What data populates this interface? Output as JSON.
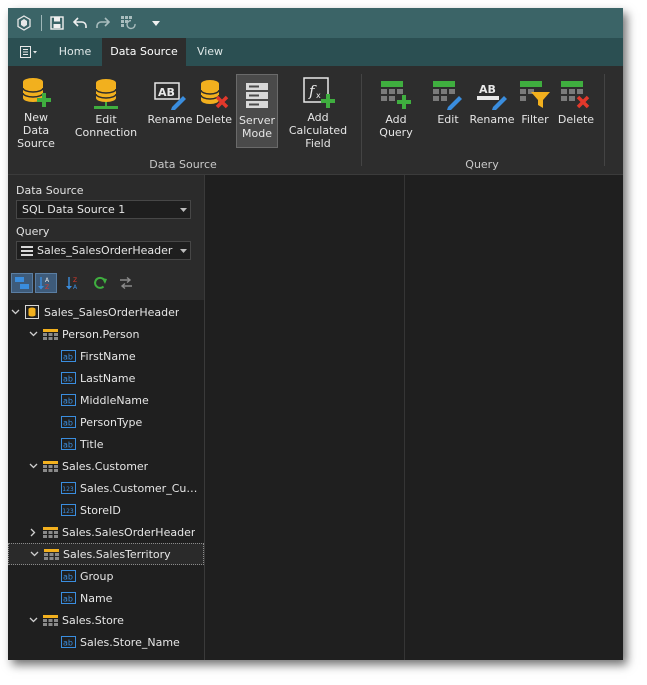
{
  "tabs": [
    {
      "label": "Home",
      "active": false
    },
    {
      "label": "Data Source",
      "active": true
    },
    {
      "label": "View",
      "active": false
    }
  ],
  "ribbon": {
    "data_source_group": {
      "label": "Data Source",
      "buttons": [
        {
          "label": "New Data\nSource",
          "icon": "database-add-icon"
        },
        {
          "label": "Edit Connection",
          "icon": "database-connection-icon"
        },
        {
          "label": "Rename",
          "icon": "rename-icon"
        },
        {
          "label": "Delete",
          "icon": "database-delete-icon"
        },
        {
          "label": "Server\nMode",
          "icon": "server-icon",
          "pressed": true
        },
        {
          "label": "Add Calculated\nField",
          "icon": "function-add-icon"
        }
      ]
    },
    "query_group": {
      "label": "Query",
      "buttons": [
        {
          "label": "Add Query",
          "icon": "table-add-icon"
        },
        {
          "label": "Edit",
          "icon": "table-edit-icon"
        },
        {
          "label": "Rename",
          "icon": "rename-icon"
        },
        {
          "label": "Filter",
          "icon": "table-filter-icon"
        },
        {
          "label": "Delete",
          "icon": "table-delete-icon"
        }
      ]
    }
  },
  "panel": {
    "data_source_label": "Data Source",
    "data_source_value": "SQL Data Source 1",
    "query_label": "Query",
    "query_value": "Sales_SalesOrderHeader"
  },
  "tree": [
    {
      "level": 0,
      "text": "Sales_SalesOrderHeader",
      "icon": "query-icon",
      "expanded": true
    },
    {
      "level": 1,
      "text": "Person.Person",
      "icon": "table-icon",
      "expanded": true
    },
    {
      "level": 2,
      "text": "FirstName",
      "icon": "string-field-icon"
    },
    {
      "level": 2,
      "text": "LastName",
      "icon": "string-field-icon"
    },
    {
      "level": 2,
      "text": "MiddleName",
      "icon": "string-field-icon"
    },
    {
      "level": 2,
      "text": "PersonType",
      "icon": "string-field-icon"
    },
    {
      "level": 2,
      "text": "Title",
      "icon": "string-field-icon"
    },
    {
      "level": 1,
      "text": "Sales.Customer",
      "icon": "table-icon",
      "expanded": true
    },
    {
      "level": 2,
      "text": "Sales.Customer_Custo…",
      "icon": "number-field-icon"
    },
    {
      "level": 2,
      "text": "StoreID",
      "icon": "number-field-icon"
    },
    {
      "level": 1,
      "text": "Sales.SalesOrderHeader",
      "icon": "table-icon",
      "expanded": false
    },
    {
      "level": 1,
      "text": "Sales.SalesTerritory",
      "icon": "table-icon",
      "expanded": true,
      "selected": true
    },
    {
      "level": 2,
      "text": "Group",
      "icon": "string-field-icon"
    },
    {
      "level": 2,
      "text": "Name",
      "icon": "string-field-icon"
    },
    {
      "level": 1,
      "text": "Sales.Store",
      "icon": "table-icon",
      "expanded": true
    },
    {
      "level": 2,
      "text": "Sales.Store_Name",
      "icon": "string-field-icon"
    }
  ],
  "colors": {
    "titlebar": "#3b6467",
    "ribbon": "#2d2d2d",
    "accent_yellow": "#f2b01e",
    "accent_green": "#3fae3f",
    "accent_blue": "#3a8dde",
    "accent_red": "#e2382b"
  }
}
